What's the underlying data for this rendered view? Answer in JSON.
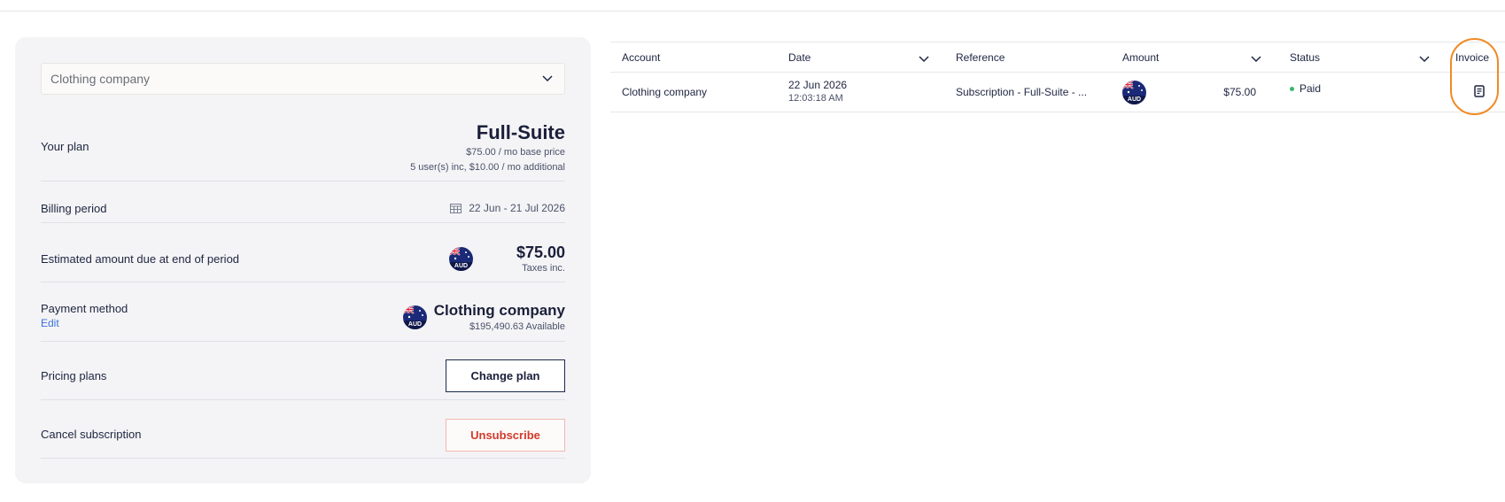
{
  "account_select": {
    "value": "Clothing company"
  },
  "plan": {
    "label": "Your plan",
    "name": "Full-Suite",
    "base_price": "$75.00 / mo base price",
    "users": "5 user(s) inc, $10.00 / mo additional"
  },
  "billing": {
    "label": "Billing period",
    "period": "22 Jun - 21 Jul 2026"
  },
  "estimate": {
    "label": "Estimated amount due at end of period",
    "amount": "$75.00",
    "note": "Taxes inc.",
    "currency": "AUD"
  },
  "payment": {
    "label": "Payment method",
    "edit": "Edit",
    "name": "Clothing company",
    "available": "$195,490.63 Available",
    "currency": "AUD"
  },
  "pricing": {
    "label": "Pricing plans",
    "button": "Change plan"
  },
  "cancel": {
    "label": "Cancel subscription",
    "button": "Unsubscribe"
  },
  "table": {
    "headers": {
      "account": "Account",
      "date": "Date",
      "reference": "Reference",
      "amount": "Amount",
      "status": "Status",
      "invoice": "Invoice"
    },
    "rows": [
      {
        "account": "Clothing company",
        "date": "22 Jun 2026",
        "time": "12:03:18 AM",
        "reference": "Subscription - Full-Suite - ...",
        "currency": "AUD",
        "amount": "$75.00",
        "status": "Paid"
      }
    ]
  },
  "colors": {
    "accent": "#f08a24",
    "paid": "#3cb56e",
    "danger": "#d23a2a",
    "link": "#3a6fd8"
  },
  "icons": [
    "chevron-down-icon",
    "calendar-icon",
    "au-flag-icon",
    "invoice-document-icon"
  ]
}
